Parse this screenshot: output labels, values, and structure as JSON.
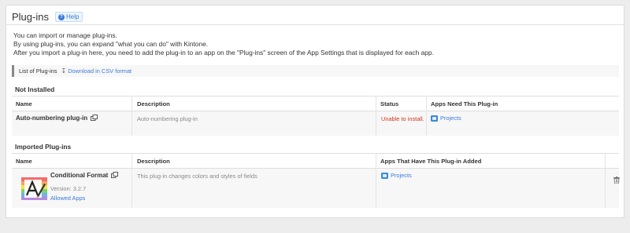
{
  "header": {
    "title": "Plug-ins",
    "help_label": "Help"
  },
  "intro": [
    "You can import or manage plug-ins.",
    "By using plug-ins, you can expand \"what you can do\" with Kintone.",
    "After you import a plug-in here, you need to add the plug-in to an app on the \"Plug-ins\" screen of the App Settings that is displayed for each app."
  ],
  "csv": {
    "label": "List of Plug-ins",
    "link": "Download in CSV format"
  },
  "not_installed": {
    "section_title": "Not Installed",
    "columns": {
      "name": "Name",
      "description": "Description",
      "status": "Status",
      "apps": "Apps Need This Plug-in"
    },
    "rows": [
      {
        "name": "Auto-numbering plug-in",
        "description": "Auto-numbering plug-in",
        "status": "Unable to install.",
        "app": "Projects"
      }
    ]
  },
  "imported": {
    "section_title": "Imported Plug-ins",
    "columns": {
      "name": "Name",
      "description": "Description",
      "apps": "Apps That Have This Plug-in Added"
    },
    "rows": [
      {
        "name": "Conditional Format",
        "version": "Version: 3.2.7",
        "allowed_apps": "Allowed Apps",
        "description": "This plug-in changes colors and styles of fields",
        "app": "Projects"
      }
    ]
  },
  "colors": {
    "link": "#3b7bd6",
    "error": "#d0341e",
    "app_icon": "#3a8ad8"
  }
}
